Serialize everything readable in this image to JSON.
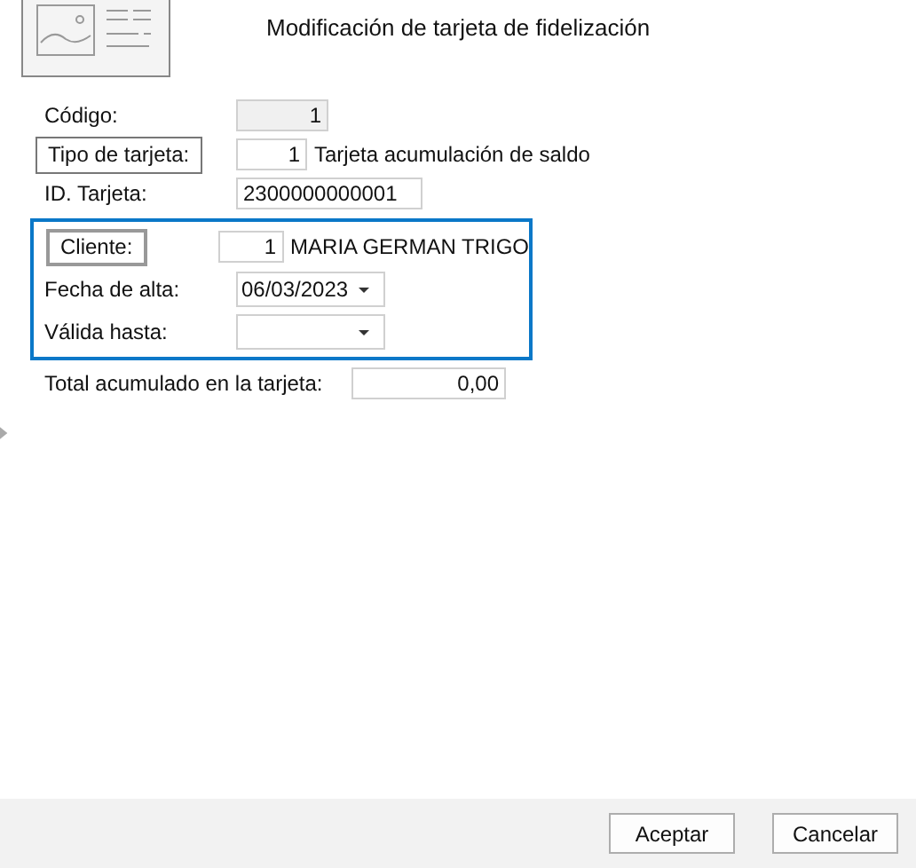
{
  "header": {
    "title": "Modificación de tarjeta de fidelización"
  },
  "fields": [
    {
      "kind": "readonly",
      "label": "Código:",
      "value": "1"
    },
    {
      "kind": "lookup",
      "label": "Tipo de tarjeta:",
      "value": "1",
      "description": "Tarjeta acumulación de saldo"
    },
    {
      "kind": "text",
      "label": "ID. Tarjeta:",
      "value": "2300000000001"
    }
  ],
  "group": [
    {
      "kind": "lookup",
      "label": "Cliente:",
      "value": "1",
      "description": "MARIA GERMAN TRIGO"
    },
    {
      "kind": "date",
      "label": "Fecha de alta:",
      "value": "06/03/2023"
    },
    {
      "kind": "date",
      "label": "Válida hasta:"
    }
  ],
  "total": {
    "label": "Total acumulado en la tarjeta:",
    "value": "0,00"
  },
  "buttons": [
    "Aceptar",
    "Cancelar"
  ]
}
